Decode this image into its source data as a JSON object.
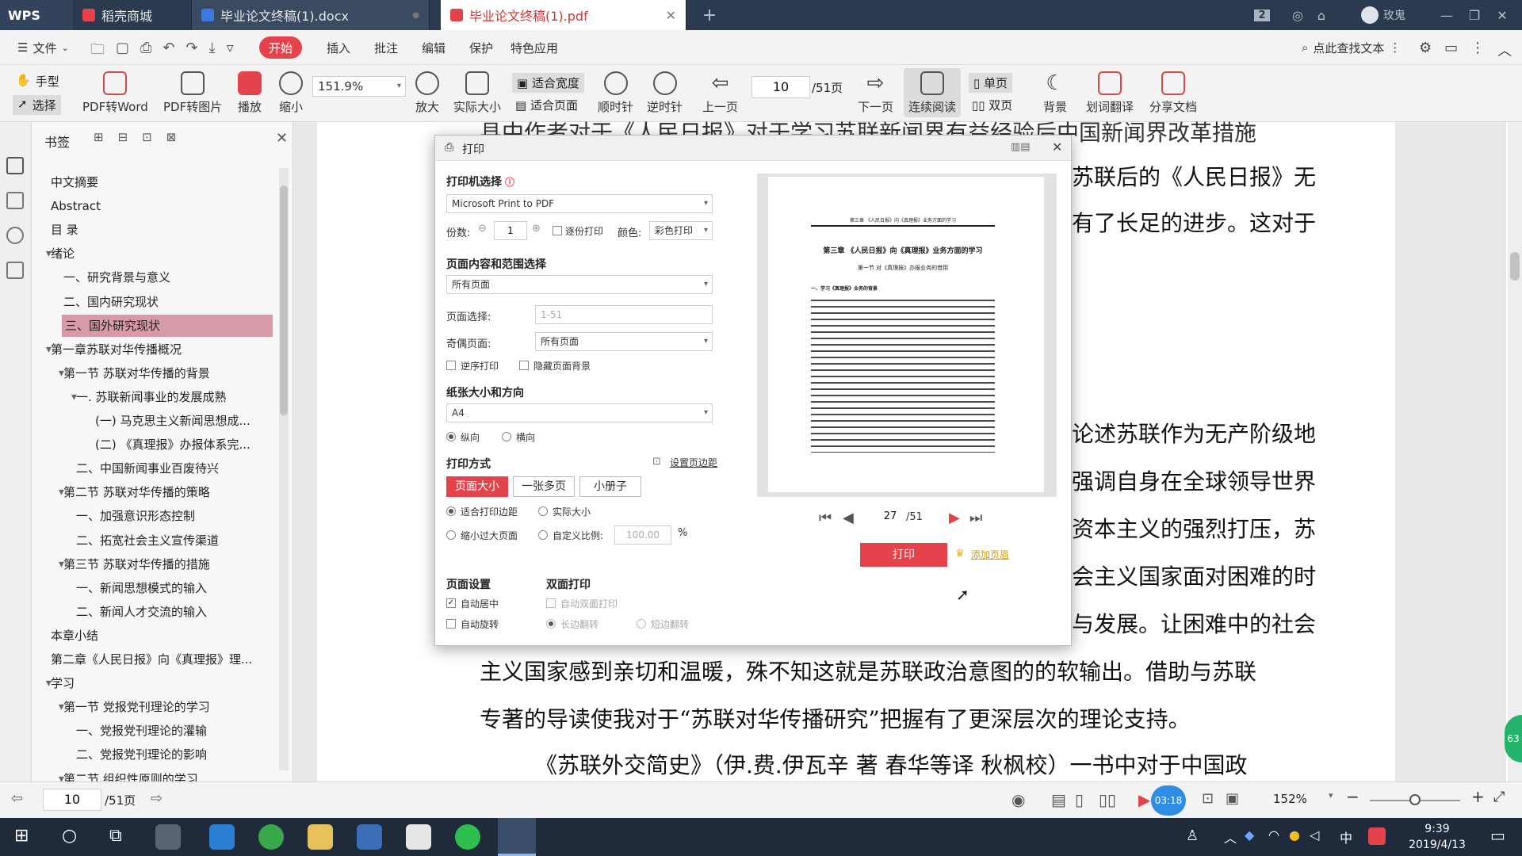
{
  "titlebar": {
    "app": "WPS",
    "tabs": [
      {
        "label": "稻壳商城"
      },
      {
        "label": "毕业论文终稿(1).docx"
      },
      {
        "label": "毕业论文终稿(1).pdf"
      }
    ],
    "add_tab": "+",
    "badge": "2",
    "user": "玫鬼"
  },
  "menu": {
    "file": "文件",
    "items": [
      "开始",
      "插入",
      "批注",
      "编辑",
      "保护",
      "特色应用"
    ],
    "search": "点此查找文本"
  },
  "toolbar": {
    "hand": "手型",
    "select": "选择",
    "pdf_word": "PDF转Word",
    "pdf_image": "PDF转图片",
    "play": "播放",
    "zoom_out": "缩小",
    "zoom_value": "151.9%",
    "zoom_in": "放大",
    "actual_size": "实际大小",
    "fit_width": "适合宽度",
    "fit_page": "适合页面",
    "rotate_cw": "顺时针",
    "rotate_ccw": "逆时针",
    "prev_page": "上一页",
    "page_input": "10",
    "page_total": "/51页",
    "next_page": "下一页",
    "continuous": "连续阅读",
    "single": "单页",
    "double": "双页",
    "background": "背景",
    "translate": "划词翻译",
    "share": "分享文档"
  },
  "bookmarks": {
    "title": "书签",
    "items": [
      {
        "label": "中文摘要"
      },
      {
        "label": "Abstract"
      },
      {
        "label": "目 录"
      },
      {
        "label": "绪论"
      },
      {
        "label": "一、研究背景与意义"
      },
      {
        "label": "二、国内研究现状"
      },
      {
        "label": "三、国外研究现状"
      },
      {
        "label": "第一章苏联对华传播概况"
      },
      {
        "label": "第一节 苏联对华传播的背景"
      },
      {
        "label": "一. 苏联新闻事业的发展成熟"
      },
      {
        "label": "(一) 马克思主义新闻思想成..."
      },
      {
        "label": "(二) 《真理报》办报体系完..."
      },
      {
        "label": "二、中国新闻事业百废待兴"
      },
      {
        "label": "第二节 苏联对华传播的策略"
      },
      {
        "label": "一、加强意识形态控制"
      },
      {
        "label": "二、拓宽社会主义宣传渠道"
      },
      {
        "label": "第三节 苏联对华传播的措施"
      },
      {
        "label": "一、新闻思想模式的输入"
      },
      {
        "label": "二、新闻人才交流的输入"
      },
      {
        "label": "本章小结"
      },
      {
        "label": "第二章《人民日报》向《真理报》理..."
      },
      {
        "label": "学习"
      },
      {
        "label": "第一节 党报党刊理论的学习"
      },
      {
        "label": "一、党报党刊理论的灌输"
      },
      {
        "label": "二、党报党刊理论的影响"
      },
      {
        "label": "第二节 组织性原则的学习"
      }
    ]
  },
  "document": {
    "lines": [
      "县中作者对于《人民日报》对于学习苏联新闻界有益经验后中国新闻界改革措施",
      "苏联后的《人民日报》无",
      "有了长足的进步。这对于",
      "论述苏联作为无产阶级地",
      "强调自身在全球领导世界",
      "资本主义的强烈打压，苏",
      "会主义国家面对困难的时",
      "与发展。让困难中的社会",
      "主义国家感到亲切和温暖，殊不知这就是苏联政治意图的的软输出。借助与苏联",
      "专著的导读使我对于“苏联对华传播研究”把握有了更深层次的理论支持。",
      "《苏联外交简史》（伊.费.伊瓦辛  著  春华等译  秋枫校）一书中对于中国政"
    ]
  },
  "print_dialog": {
    "title": "打印",
    "printer_section": "打印机选择",
    "printer": "Microsoft Print to PDF",
    "copies_label": "份数:",
    "copies": "1",
    "collate": "逐份打印",
    "color_label": "颜色:",
    "color": "彩色打印",
    "range_section": "页面内容和范围选择",
    "range": "所有页面",
    "page_select_label": "页面选择:",
    "page_select_placeholder": "1-51",
    "odd_even_label": "奇偶页面:",
    "odd_even": "所有页面",
    "reverse": "逆序打印",
    "hide_bg": "隐藏页面背景",
    "paper_section": "纸张大小和方向",
    "paper": "A4",
    "portrait": "纵向",
    "landscape": "横向",
    "mode_section": "打印方式",
    "margins_link": "设置页边距",
    "mode_buttons": [
      "页面大小",
      "一张多页",
      "小册子"
    ],
    "fit_margins": "适合打印边距",
    "actual": "实际大小",
    "shrink": "缩小过大页面",
    "custom_scale": "自定义比例:",
    "scale_value": "100.00",
    "percent": "%",
    "page_setup": "页面设置",
    "auto_center": "自动居中",
    "auto_rotate": "自动旋转",
    "duplex": "双面打印",
    "auto_duplex": "自动双面打印",
    "long_edge": "长边翻转",
    "short_edge": "短边翻转",
    "preview_page": "27",
    "preview_total": "/51",
    "print_button": "打印",
    "add_watermark": "添加页眉",
    "preview": {
      "header": "第三章 《人民日报》向《真理报》业务方面的学习",
      "chapter": "第三章 《人民日报》向《真理报》业务方面的学习",
      "section": "第一节 对《真理报》办报业务的借用",
      "sub": "一、学习《真理报》业务的背景"
    }
  },
  "statusbar": {
    "page_input": "10",
    "page_total": "/51页",
    "timer": "03:18",
    "zoom": "152%"
  },
  "taskbar": {
    "time": "9:39",
    "date": "2019/4/13",
    "ime": "中",
    "side_badge": "63"
  }
}
